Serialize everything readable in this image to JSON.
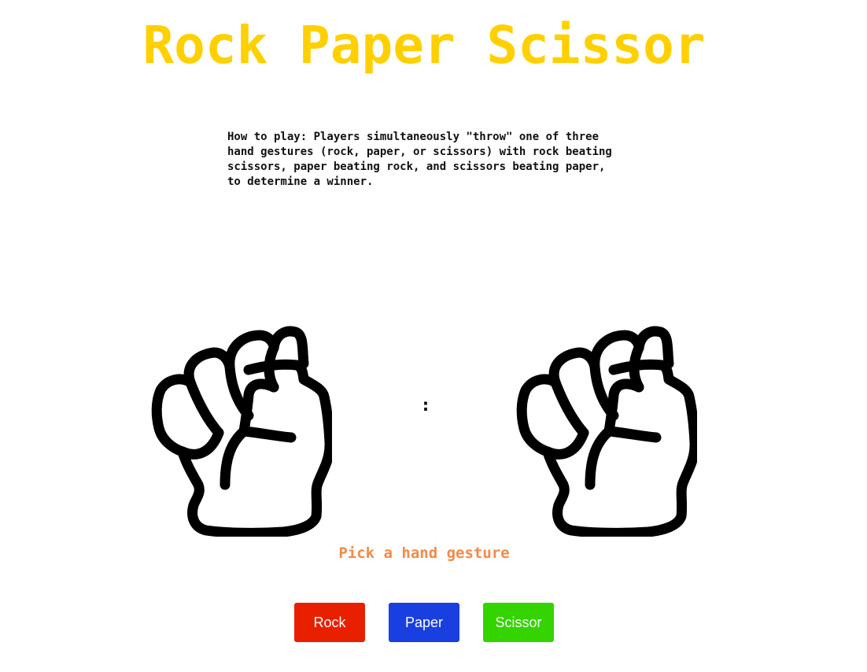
{
  "title": "Rock Paper Scissor",
  "instructions": "How to play: Players simultaneously \"throw\" one of three hand gestures (rock, paper, or scissors) with rock beating scissors, paper beating rock, and scissors beating paper, to determine a winner.",
  "score_separator": ":",
  "status_message": "Pick a hand gesture",
  "player_hand_icon": "fist-icon",
  "computer_hand_icon": "fist-icon",
  "buttons": {
    "rock": "Rock",
    "paper": "Paper",
    "scissor": "Scissor"
  },
  "colors": {
    "title": "#ffd000",
    "status": "#f5894a",
    "rock_button": "#e82000",
    "paper_button": "#1a3fe0",
    "scissor_button": "#33d400"
  }
}
